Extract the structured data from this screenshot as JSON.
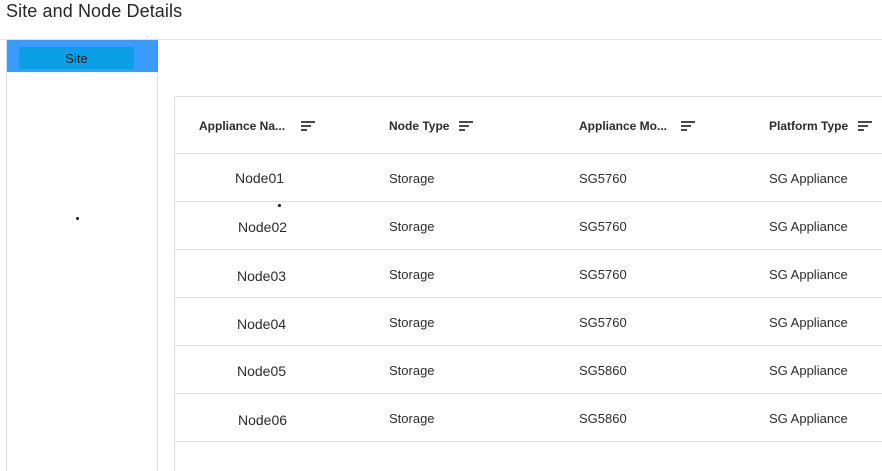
{
  "page": {
    "title": "Site and Node Details"
  },
  "sidebar": {
    "site_tab_label": "Site"
  },
  "table": {
    "columns": [
      {
        "label": "Appliance Na..."
      },
      {
        "label": "Node Type"
      },
      {
        "label": "Appliance Mo..."
      },
      {
        "label": "Platform Type"
      }
    ],
    "rows": [
      {
        "name": "Node01",
        "node_type": "Storage",
        "model": "SG5760",
        "platform": "SG Appliance"
      },
      {
        "name": "Node02",
        "node_type": "Storage",
        "model": "SG5760",
        "platform": "SG Appliance"
      },
      {
        "name": "Node03",
        "node_type": "Storage",
        "model": "SG5760",
        "platform": "SG Appliance"
      },
      {
        "name": "Node04",
        "node_type": "Storage",
        "model": "SG5760",
        "platform": "SG Appliance"
      },
      {
        "name": "Node05",
        "node_type": "Storage",
        "model": "SG5860",
        "platform": "SG Appliance"
      },
      {
        "name": "Node06",
        "node_type": "Storage",
        "model": "SG5860",
        "platform": "SG Appliance"
      }
    ]
  }
}
